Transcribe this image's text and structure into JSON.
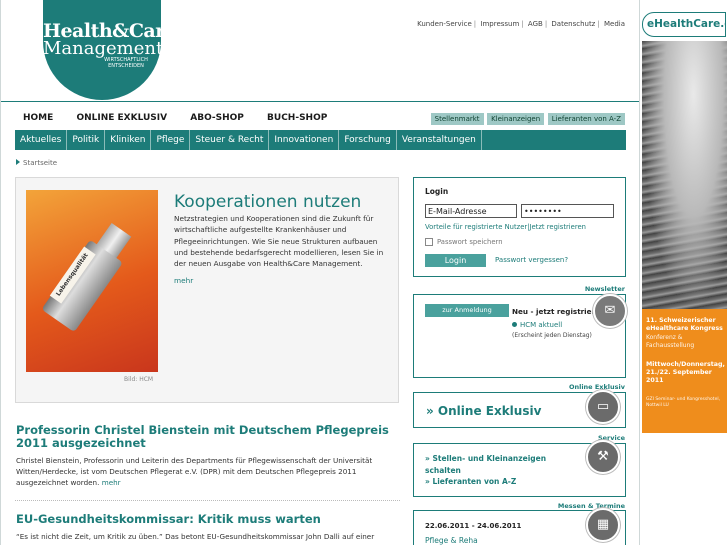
{
  "logo": {
    "line1": "Health&Care",
    "line2": "Management",
    "tagline": "WIRTSCHAFTLICH ENTSCHEIDEN"
  },
  "meta_links": [
    "Kunden-Service",
    "Impressum",
    "AGB",
    "Datenschutz",
    "Media"
  ],
  "main_nav": [
    "HOME",
    "ONLINE EXKLUSIV",
    "ABO-SHOP",
    "BUCH-SHOP"
  ],
  "right_nav": [
    "Stellenmarkt",
    "Kleinanzeigen",
    "Lieferanten von A-Z"
  ],
  "sub_nav": [
    "Aktuelles",
    "Politik",
    "Kliniken",
    "Pflege",
    "Steuer & Recht",
    "Innovationen",
    "Forschung",
    "Veranstaltungen"
  ],
  "breadcrumb": "Startseite",
  "teaser": {
    "title": "Kooperationen nutzen",
    "text": "Netzstrategien und Kooperationen sind die Zukunft für wirtschaftliche aufgestellte Krankenhäuser und Pflegeeinrichtungen. Wie Sie neue Strukturen aufbauen und bestehende bedarfsgerecht modellieren, lesen Sie in der neuen Ausgabe von Health&Care Management.",
    "more": "mehr",
    "image_label": "Lebensqualität",
    "credit": "Bild: HCM"
  },
  "articles": [
    {
      "title": "Professorin Christel Bienstein mit Deutschem Pflegepreis 2011 ausgezeichnet",
      "text": "Christel Bienstein, Professorin und Leiterin des Departments für Pflegewissenschaft der Universität Witten/Herdecke, ist vom Deutschen Pflegerat e.V. (DPR) mit dem Deutschen Pflegepreis 2011 ausgezeichnet worden.",
      "more": "mehr"
    },
    {
      "title": "EU-Gesundheitskommissar: Kritik muss warten",
      "text": "“Es ist nicht die Zeit, um Kritik zu üben.” Das betont EU-Gesundheitskommissar John Dalli auf einer"
    }
  ],
  "login": {
    "title": "Login",
    "email_value": "E-Mail-Adresse",
    "password_value": "••••••••",
    "register_link": "Vorteile für registrierte Nutzer",
    "register_link2": "Jetzt registrieren",
    "remember": "Passwort speichern",
    "button": "Login",
    "forgot": "Passwort vergessen?"
  },
  "newsletter": {
    "label": "Newsletter",
    "button": "zur Anmeldung",
    "title": "Neu - jetzt registrieren",
    "link": "HCM aktuell",
    "note": "(Erscheint jeden Dienstag)"
  },
  "exklusiv": {
    "label": "Online Exklusiv",
    "text": "» Online Exklusiv"
  },
  "service": {
    "label": "Service",
    "items": [
      "» Stellen- und Kleinanzeigen schalten",
      "» Lieferanten von A-Z"
    ]
  },
  "messen": {
    "label": "Messen & Termine",
    "date": "22.06.2011 - 24.06.2011",
    "name": "Pflege & Reha"
  },
  "ad": {
    "logo": "eHealthCare.ch",
    "line1": "11. Schweizerischer eHealthcare Kongress",
    "line2": "Konferenz & Fachausstellung",
    "line3": "Mittwoch/Donnerstag, 21./22. September 2011",
    "line4": "GZI Seminar- und Kongresshotel, Nottwil LU"
  },
  "colors": {
    "brand": "#1d7c79",
    "button": "#4aa19d",
    "ad_orange": "#ef8d1c"
  }
}
